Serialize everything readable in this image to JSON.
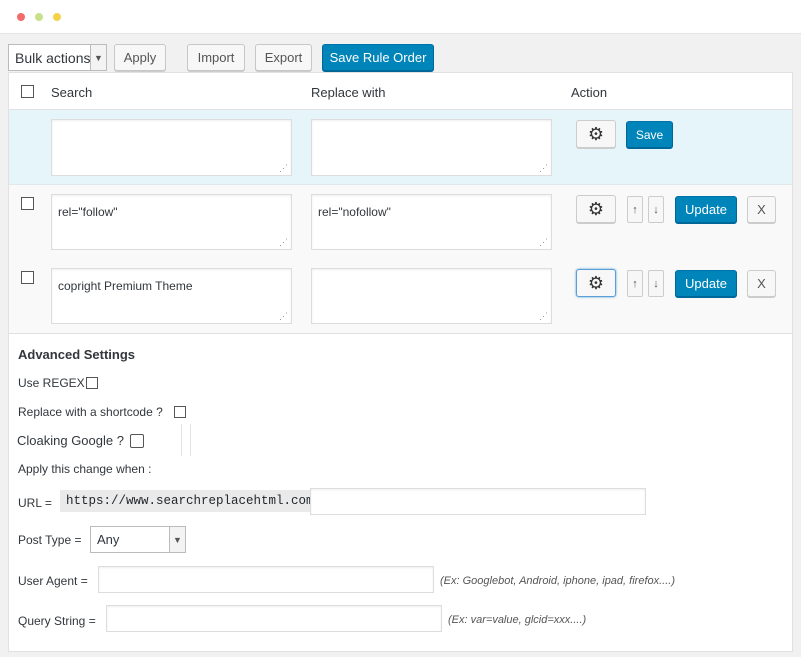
{
  "window": {
    "controls": [
      "close",
      "minimize",
      "maximize"
    ]
  },
  "toolbar": {
    "bulk_actions": "Bulk actions",
    "apply": "Apply",
    "import": "Import",
    "export": "Export",
    "save_order": "Save Rule Order"
  },
  "table": {
    "headers": {
      "search": "Search",
      "replace": "Replace with",
      "action": "Action"
    },
    "new_rule": {
      "search": "",
      "replace": "",
      "save": "Save"
    },
    "rules": [
      {
        "search": "rel=\"follow\"",
        "replace": "rel=\"nofollow\"",
        "update": "Update",
        "remove": "X",
        "up": "↑",
        "down": "↓"
      },
      {
        "search": "copright Premium Theme",
        "replace": "",
        "update": "Update",
        "remove": "X",
        "up": "↑",
        "down": "↓"
      }
    ]
  },
  "advanced": {
    "title": "Advanced Settings",
    "use_regex": "Use REGEX",
    "shortcode": "Replace with a shortcode ?",
    "cloaking": "Cloaking Google ?",
    "apply_when": "Apply this change when :",
    "url_label": "URL =",
    "url_prefix": "https://www.searchreplacehtml.com",
    "url_value": "",
    "post_type_label": "Post Type =",
    "post_type_value": "Any",
    "user_agent_label": "User Agent =",
    "user_agent_value": "",
    "user_agent_hint": "(Ex: Googlebot, Android, iphone, ipad, firefox....)",
    "query_label": "Query String =",
    "query_value": "",
    "query_hint": "(Ex: var=value, glcid=xxx....)"
  }
}
